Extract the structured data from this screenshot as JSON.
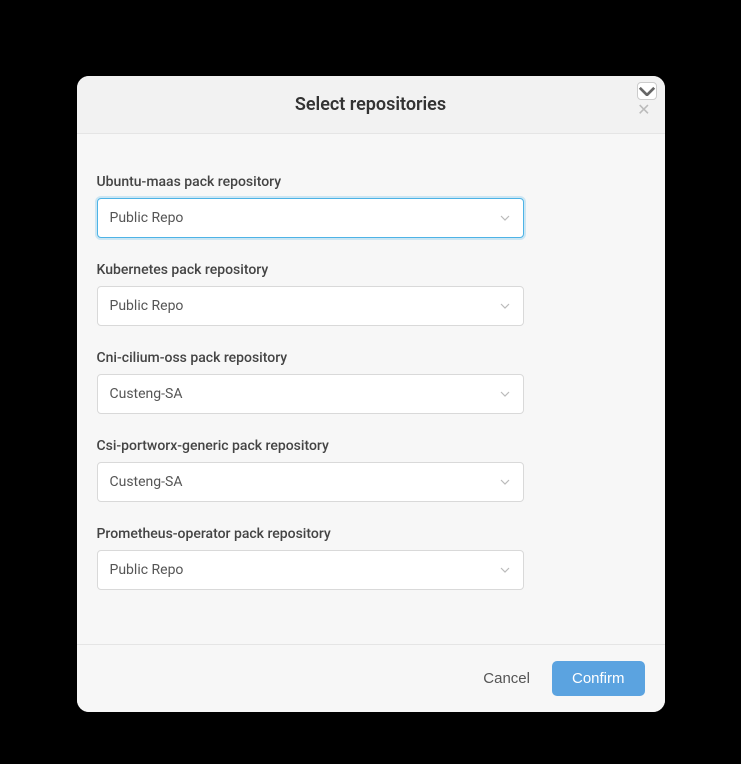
{
  "modal": {
    "title": "Select repositories",
    "fields": [
      {
        "label": "Ubuntu-maas pack repository",
        "value": "Public Repo",
        "focused": true
      },
      {
        "label": "Kubernetes pack repository",
        "value": "Public Repo",
        "focused": false
      },
      {
        "label": "Cni-cilium-oss pack repository",
        "value": "Custeng-SA",
        "focused": false
      },
      {
        "label": "Csi-portworx-generic pack repository",
        "value": "Custeng-SA",
        "focused": false
      },
      {
        "label": "Prometheus-operator pack repository",
        "value": "Public Repo",
        "focused": false
      }
    ],
    "footer": {
      "cancel": "Cancel",
      "confirm": "Confirm"
    }
  }
}
